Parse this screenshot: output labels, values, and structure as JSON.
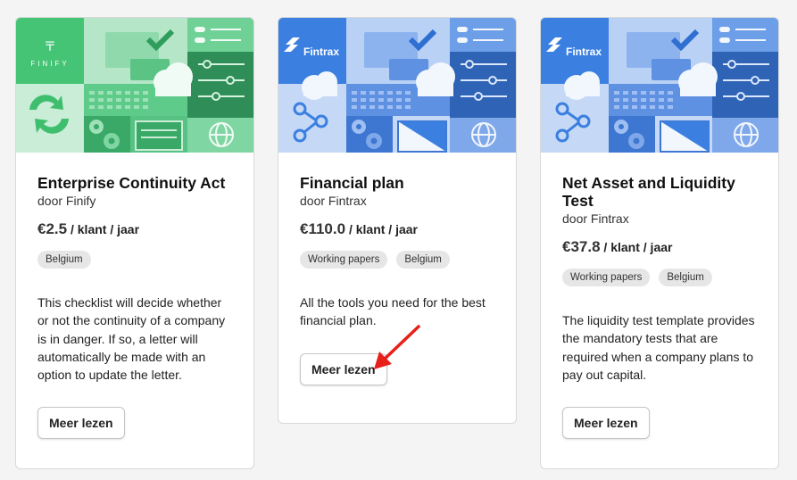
{
  "cards": [
    {
      "title": "Enterprise Continuity Act",
      "vendor": "door Finify",
      "price": "€2.5",
      "price_unit": " / klant / jaar",
      "tags": [
        "Belgium"
      ],
      "description": "This checklist will decide whether or not the continuity of a company is in danger. If so, a letter will automatically be made with an option to update the letter.",
      "button": "Meer lezen",
      "logo": "FINIFY",
      "theme": "green"
    },
    {
      "title": "Financial plan",
      "vendor": "door Fintrax",
      "price": "€110.0",
      "price_unit": " / klant / jaar",
      "tags": [
        "Working papers",
        "Belgium"
      ],
      "description": "All the tools you need for the best financial plan.",
      "button": "Meer lezen",
      "logo": "Fintrax",
      "theme": "blue"
    },
    {
      "title": "Net Asset and Liquidity Test",
      "vendor": "door Fintrax",
      "price": "€37.8",
      "price_unit": " / klant / jaar",
      "tags": [
        "Working papers",
        "Belgium"
      ],
      "description": "The liquidity test template provides the mandatory tests that are required when a company plans to pay out capital.",
      "button": "Meer lezen",
      "logo": "Fintrax",
      "theme": "blue"
    }
  ],
  "colors": {
    "green_dark": "#2e8b57",
    "green_mid": "#3fbf6e",
    "green_light": "#a8e0bd",
    "blue_dark": "#2f63b5",
    "blue_mid": "#3b7fe0",
    "blue_light": "#a9c6f2",
    "arrow": "#e8201a"
  }
}
